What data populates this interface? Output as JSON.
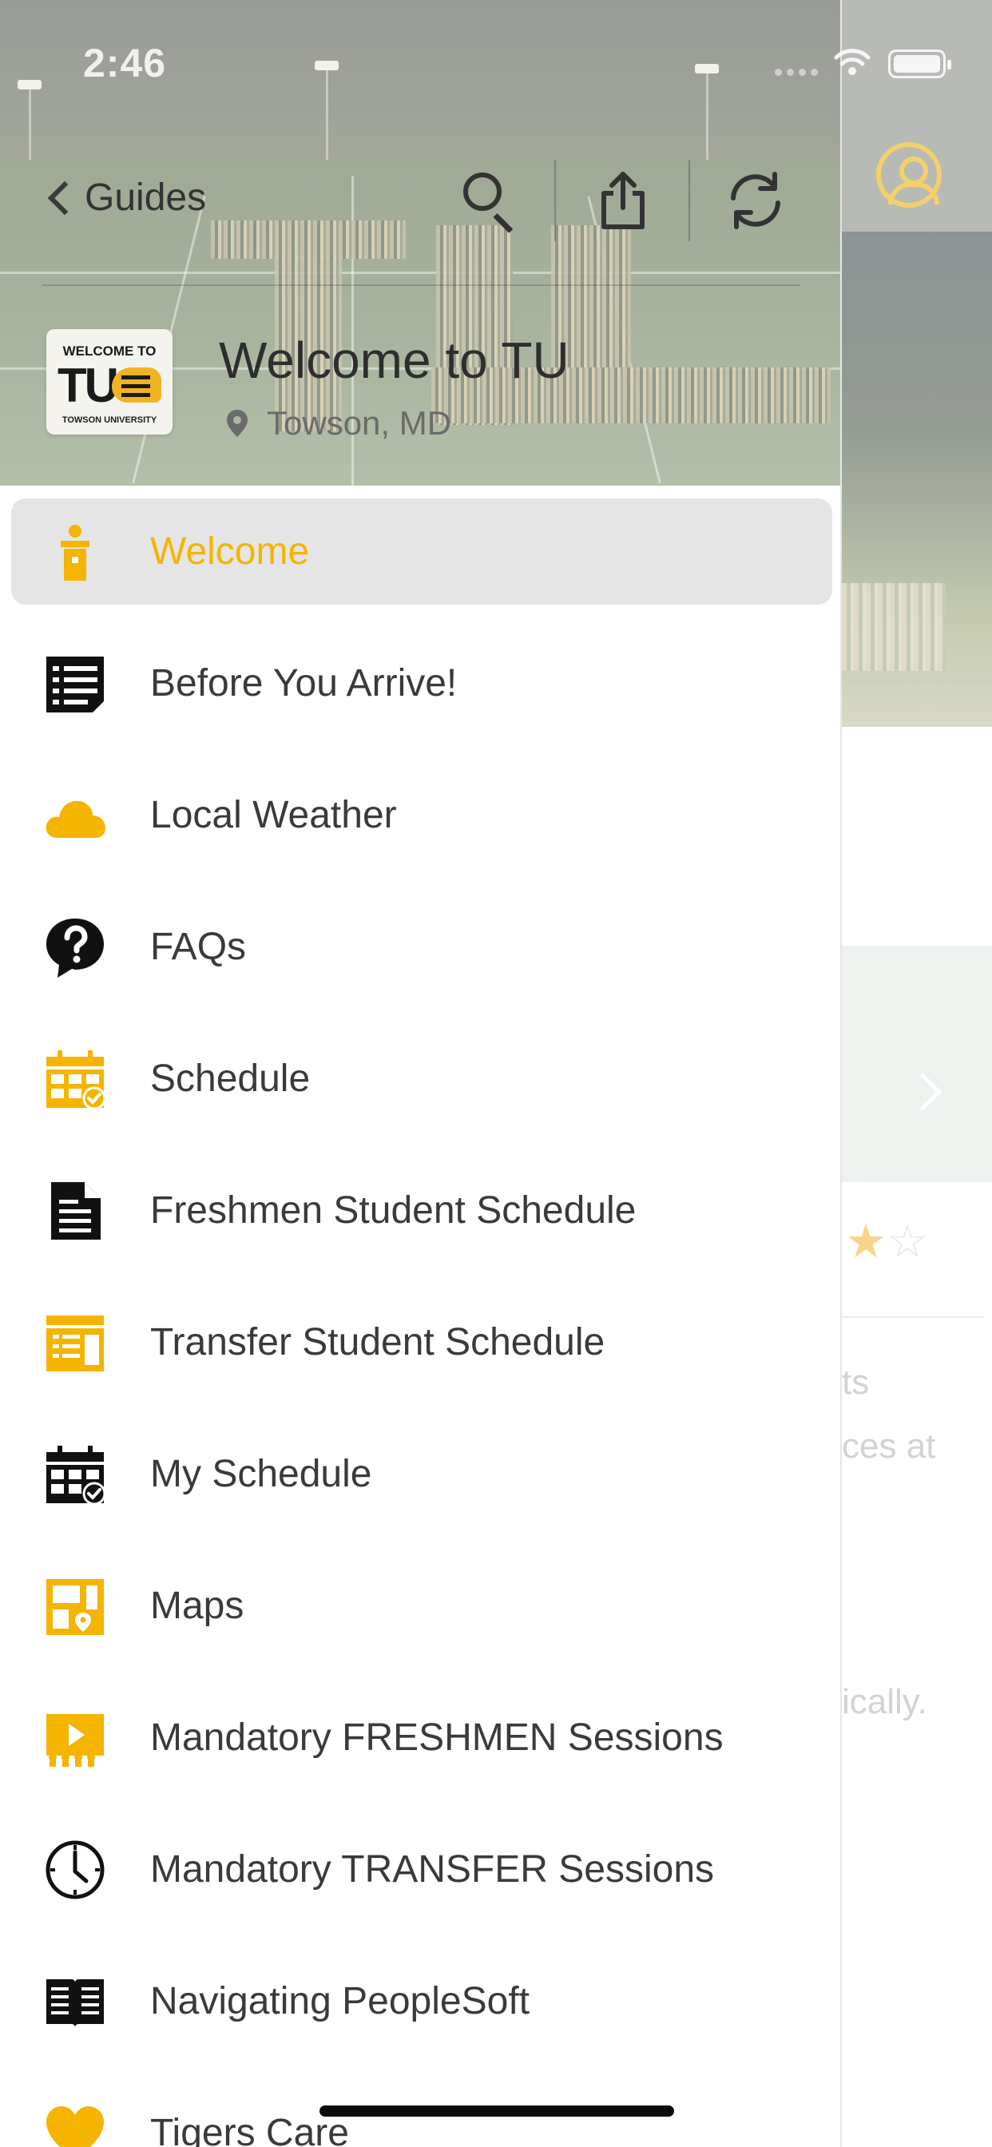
{
  "status_bar": {
    "time": "2:46"
  },
  "header": {
    "back_label": "Guides",
    "guide_title": "Welcome to TU",
    "guide_location": "Towson, MD",
    "logo": {
      "top_text": "WELCOME TO",
      "main_text": "TU",
      "bottom_text": "TOWSON UNIVERSITY"
    }
  },
  "menu": {
    "items": [
      {
        "label": "Welcome",
        "icon": "podium-icon",
        "active": true
      },
      {
        "label": "Before You Arrive!",
        "icon": "list-icon"
      },
      {
        "label": "Local Weather",
        "icon": "cloud-icon"
      },
      {
        "label": "FAQs",
        "icon": "question-bubble-icon"
      },
      {
        "label": "Schedule",
        "icon": "calendar-check-icon"
      },
      {
        "label": "Freshmen Student Schedule",
        "icon": "document-icon"
      },
      {
        "label": "Transfer Student Schedule",
        "icon": "schedule-board-icon"
      },
      {
        "label": "My Schedule",
        "icon": "calendar-check-icon"
      },
      {
        "label": "Maps",
        "icon": "map-icon"
      },
      {
        "label": "Mandatory  FRESHMEN Sessions",
        "icon": "video-stage-icon"
      },
      {
        "label": "Mandatory TRANSFER Sessions",
        "icon": "clock-icon"
      },
      {
        "label": "Navigating PeopleSoft",
        "icon": "open-book-icon"
      },
      {
        "label": "Tigers Care",
        "icon": "heart-icon"
      }
    ]
  },
  "background": {
    "text_lines": [
      "ts",
      "ces at",
      "ically."
    ],
    "rating_stars": "★☆"
  },
  "colors": {
    "accent": "#f4b400",
    "active_row": "#e5e5e5",
    "text": "#3a3a3a"
  }
}
